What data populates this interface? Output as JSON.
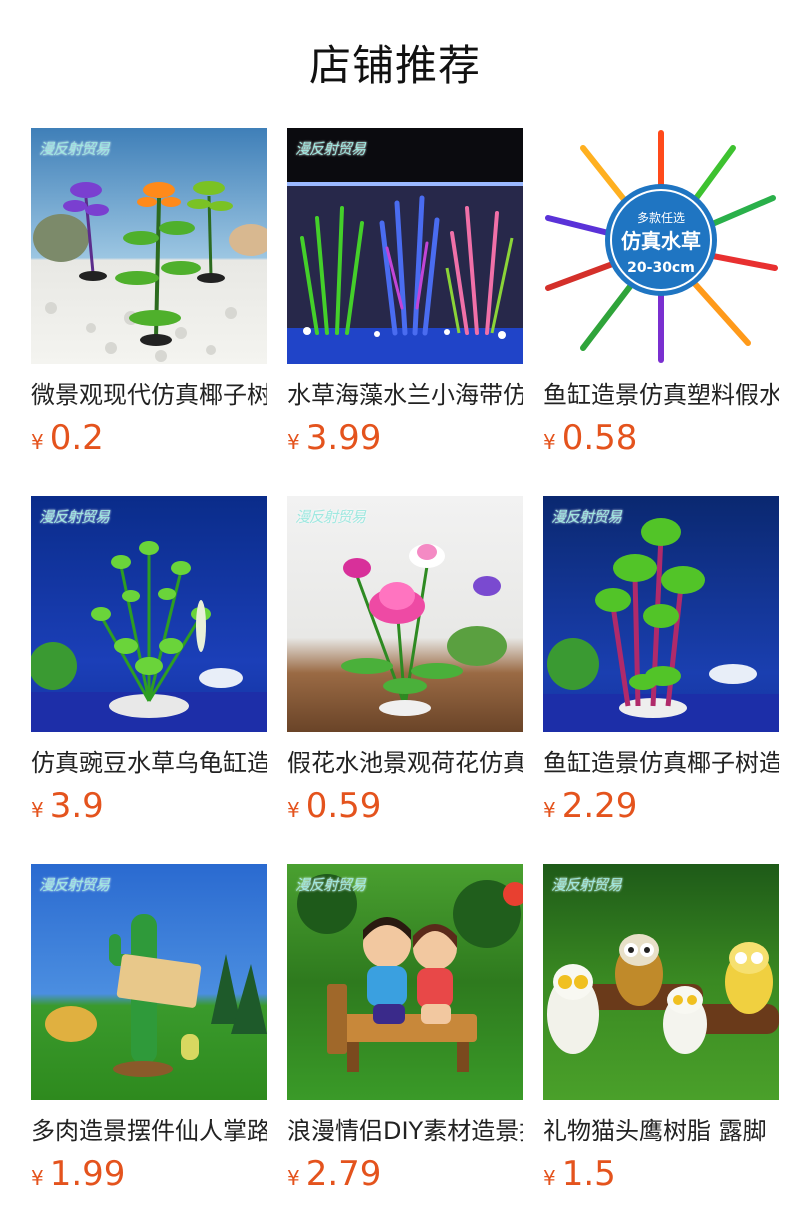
{
  "header": {
    "title": "店铺推荐"
  },
  "watermark": "漫反射贸易",
  "badge": {
    "line1": "多款任选",
    "line2": "仿真水草",
    "line3": "20-30cm"
  },
  "products": [
    {
      "name": "微景观现代仿真椰子树",
      "currency": "¥",
      "price": "0.2"
    },
    {
      "name": "水草海藻水兰小海带仿真",
      "currency": "¥",
      "price": "3.99"
    },
    {
      "name": "鱼缸造景仿真塑料假水草",
      "currency": "¥",
      "price": "0.58"
    },
    {
      "name": "仿真豌豆水草乌龟缸造景",
      "currency": "¥",
      "price": "3.9"
    },
    {
      "name": "假花水池景观荷花仿真花",
      "currency": "¥",
      "price": "0.59"
    },
    {
      "name": "鱼缸造景仿真椰子树造景",
      "currency": "¥",
      "price": "2.29"
    },
    {
      "name": "多肉造景摆件仙人掌路牌",
      "currency": "¥",
      "price": "1.99"
    },
    {
      "name": "浪漫情侣DIY素材造景摆件",
      "currency": "¥",
      "price": "2.79"
    },
    {
      "name": "礼物猫头鹰树脂 露脚",
      "currency": "¥",
      "price": "1.5"
    }
  ]
}
